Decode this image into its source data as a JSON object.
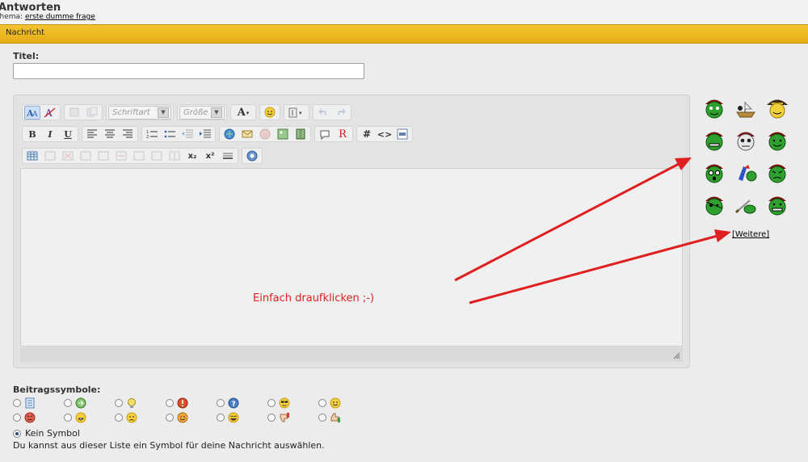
{
  "header": {
    "title": "Antworten",
    "thread_prefix": "Thema:",
    "thread_link": "erste dumme frage"
  },
  "section": {
    "label": "Nachricht"
  },
  "title_field": {
    "label": "Titel:",
    "value": ""
  },
  "toolbar": {
    "font_placeholder": "Schriftart",
    "size_placeholder": "Größe",
    "bold": "B",
    "italic": "I",
    "underline": "U",
    "hash": "#",
    "code": "<>",
    "r_button": "R",
    "text_color": "A",
    "subscript": "x₂",
    "superscript": "x²"
  },
  "annotation": {
    "text": "Einfach draufklicken ;-)"
  },
  "smilies": {
    "more_link": "[Weitere]",
    "icons": [
      "pirate-face-icon",
      "pirate-ship-icon",
      "pirate-captain-icon",
      "pirate-grin-icon",
      "pirate-skull-icon",
      "pirate-smile-icon",
      "pirate-shocked-icon",
      "pirate-parrot-icon",
      "pirate-angry-icon",
      "pirate-eyepatch-icon",
      "pirate-sword-icon",
      "pirate-happy-icon"
    ]
  },
  "post_icons": {
    "label": "Beitragssymbole:",
    "row1": [
      "document-icon",
      "arrow-icon",
      "lightbulb-icon",
      "exclamation-icon",
      "question-icon",
      "cool-icon",
      "smile-icon"
    ],
    "row2": [
      "angry-icon",
      "grin-icon",
      "sad-icon",
      "wink-icon",
      "laugh-icon",
      "thumbs-down-icon",
      "thumbs-up-icon"
    ],
    "none_label": "Kein Symbol",
    "hint": "Du kannst aus dieser Liste ein Symbol für deine Nachricht auswählen."
  },
  "colors": {
    "accent_bar": "#e9b31b",
    "annotation": "#e02020"
  }
}
